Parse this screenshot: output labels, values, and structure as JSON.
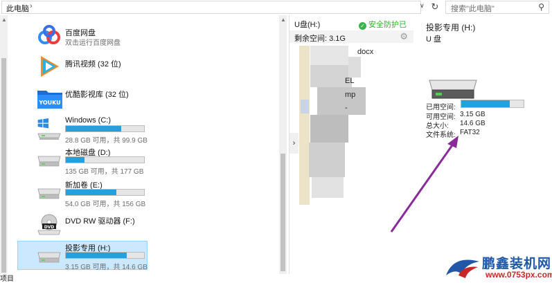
{
  "address_bar": {
    "path": "此电脑",
    "chevron": "›",
    "dropdown": "∨",
    "refresh": "↻",
    "search_placeholder": "搜索\"此电脑\""
  },
  "drives": [
    {
      "name": "百度网盘",
      "sub": "双击运行百度网盘",
      "icon": "baidu-cloud-icon"
    },
    {
      "name": "腾讯视频 (32 位)",
      "icon": "tencent-video-icon"
    },
    {
      "name": "优酷影视库 (32 位)",
      "icon": "youku-folder-icon",
      "logo_text": "YOUKU"
    },
    {
      "name": "Windows (C:)",
      "sub": "28.8 GB 可用，共 99.9 GB",
      "used_fraction": 0.71,
      "icon": "windows-drive-icon"
    },
    {
      "name": "本地磁盘 (D:)",
      "sub": "135 GB 可用，共 177 GB",
      "used_fraction": 0.24,
      "icon": "drive-icon"
    },
    {
      "name": "新加卷 (E:)",
      "sub": "54.0 GB 可用，共 156 GB",
      "used_fraction": 0.65,
      "icon": "drive-icon"
    },
    {
      "name": "DVD RW 驱动器 (F:)",
      "icon": "dvd-drive-icon",
      "logo_text": "DVD"
    },
    {
      "name": "投影专用 (H:)",
      "sub": "3.15 GB 可用，共 14.6 GB",
      "used_fraction": 0.78,
      "icon": "usb-drive-icon"
    }
  ],
  "middle": {
    "title": "U盘(H:)",
    "safe_text": "安全防护已开启",
    "free_label": "剩余空间: 3.1G",
    "expand": "›",
    "file_fragments": [
      "docx",
      "EL",
      "mp",
      "-"
    ]
  },
  "details": {
    "title": "投影专用 (H:)",
    "subtitle": "U 盘",
    "used_label": "已用空间:",
    "free_label": "可用空间:",
    "free_value": "3.15 GB",
    "total_label": "总大小:",
    "total_value": "14.6 GB",
    "fs_label": "文件系统:",
    "fs_value": "FAT32",
    "used_fraction": 0.78
  },
  "status": {
    "text": "项目"
  },
  "watermark": {
    "brand": "鹏鑫装机网",
    "url": "www.0753px.com"
  },
  "colors": {
    "accent": "#26a0da",
    "selection": "#cce8ff",
    "safe": "#35b135",
    "arrow": "#8a2a9a"
  }
}
